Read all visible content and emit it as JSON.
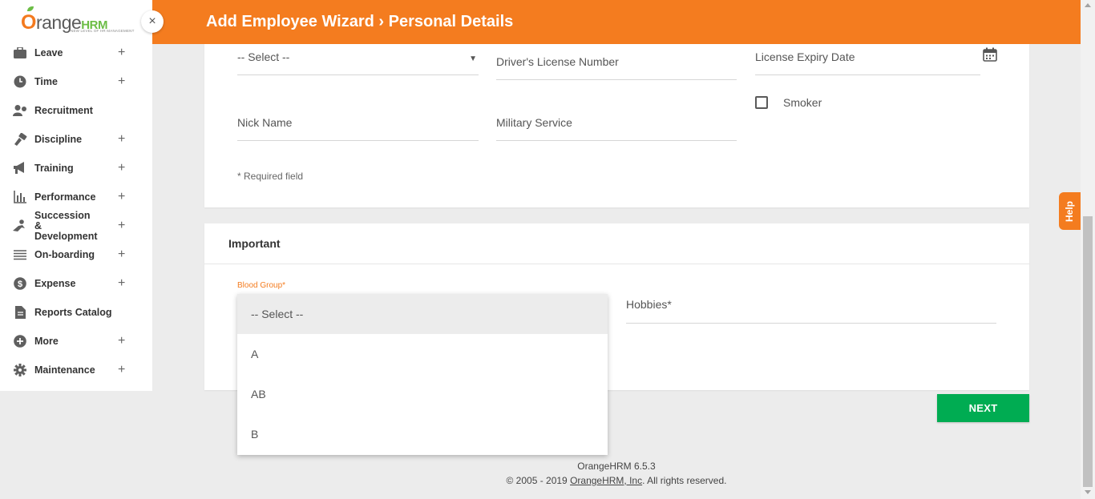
{
  "sidebar": {
    "logo": {
      "brand_prefix": "O",
      "brand_rest": "range",
      "brand_hrm": "HRM",
      "tagline": "NEW LEVEL OF HR MANAGEMENT"
    },
    "close_symbol": "×",
    "items": [
      {
        "label": "Leave",
        "icon": "briefcase-icon",
        "expandable": "+"
      },
      {
        "label": "Time",
        "icon": "clock-icon",
        "expandable": "+"
      },
      {
        "label": "Recruitment",
        "icon": "recruitment-icon",
        "expandable": ""
      },
      {
        "label": "Discipline",
        "icon": "discipline-icon",
        "expandable": "+"
      },
      {
        "label": "Training",
        "icon": "megaphone-icon",
        "expandable": "+"
      },
      {
        "label": "Performance",
        "icon": "bar-chart-icon",
        "expandable": "+"
      },
      {
        "label": "Succession & Development",
        "icon": "succession-icon",
        "expandable": "+"
      },
      {
        "label": "On-boarding",
        "icon": "layers-icon",
        "expandable": "+"
      },
      {
        "label": "Expense",
        "icon": "dollar-icon",
        "expandable": "+"
      },
      {
        "label": "Reports Catalog",
        "icon": "document-icon",
        "expandable": ""
      },
      {
        "label": "More",
        "icon": "plus-circle-icon",
        "expandable": "+"
      },
      {
        "label": "Maintenance",
        "icon": "gear-icon",
        "expandable": "+"
      }
    ]
  },
  "header": {
    "title": "Add Employee Wizard › Personal Details"
  },
  "form": {
    "select_placeholder": "-- Select --",
    "drivers_license": "Driver's License Number",
    "license_expiry": "License Expiry Date",
    "smoker": "Smoker",
    "nick_name": "Nick Name",
    "military_service": "Military Service",
    "required_note": "* Required field"
  },
  "important": {
    "title": "Important",
    "blood_group_label": "Blood Group*",
    "hobbies": "Hobbies*",
    "blood_group_options": [
      "-- Select --",
      "A",
      "AB",
      "B"
    ],
    "selected_option": "-- Select --"
  },
  "buttons": {
    "next": "NEXT",
    "help": "Help"
  },
  "footer": {
    "version": "OrangeHRM 6.5.3",
    "copyright_prefix": "© 2005 - 2019 ",
    "company_link": "OrangeHRM, Inc",
    "copyright_suffix": ". All rights reserved."
  },
  "colors": {
    "brand_orange": "#f47c1f",
    "next_green": "#00ac52",
    "logo_green": "#6bbd45"
  }
}
